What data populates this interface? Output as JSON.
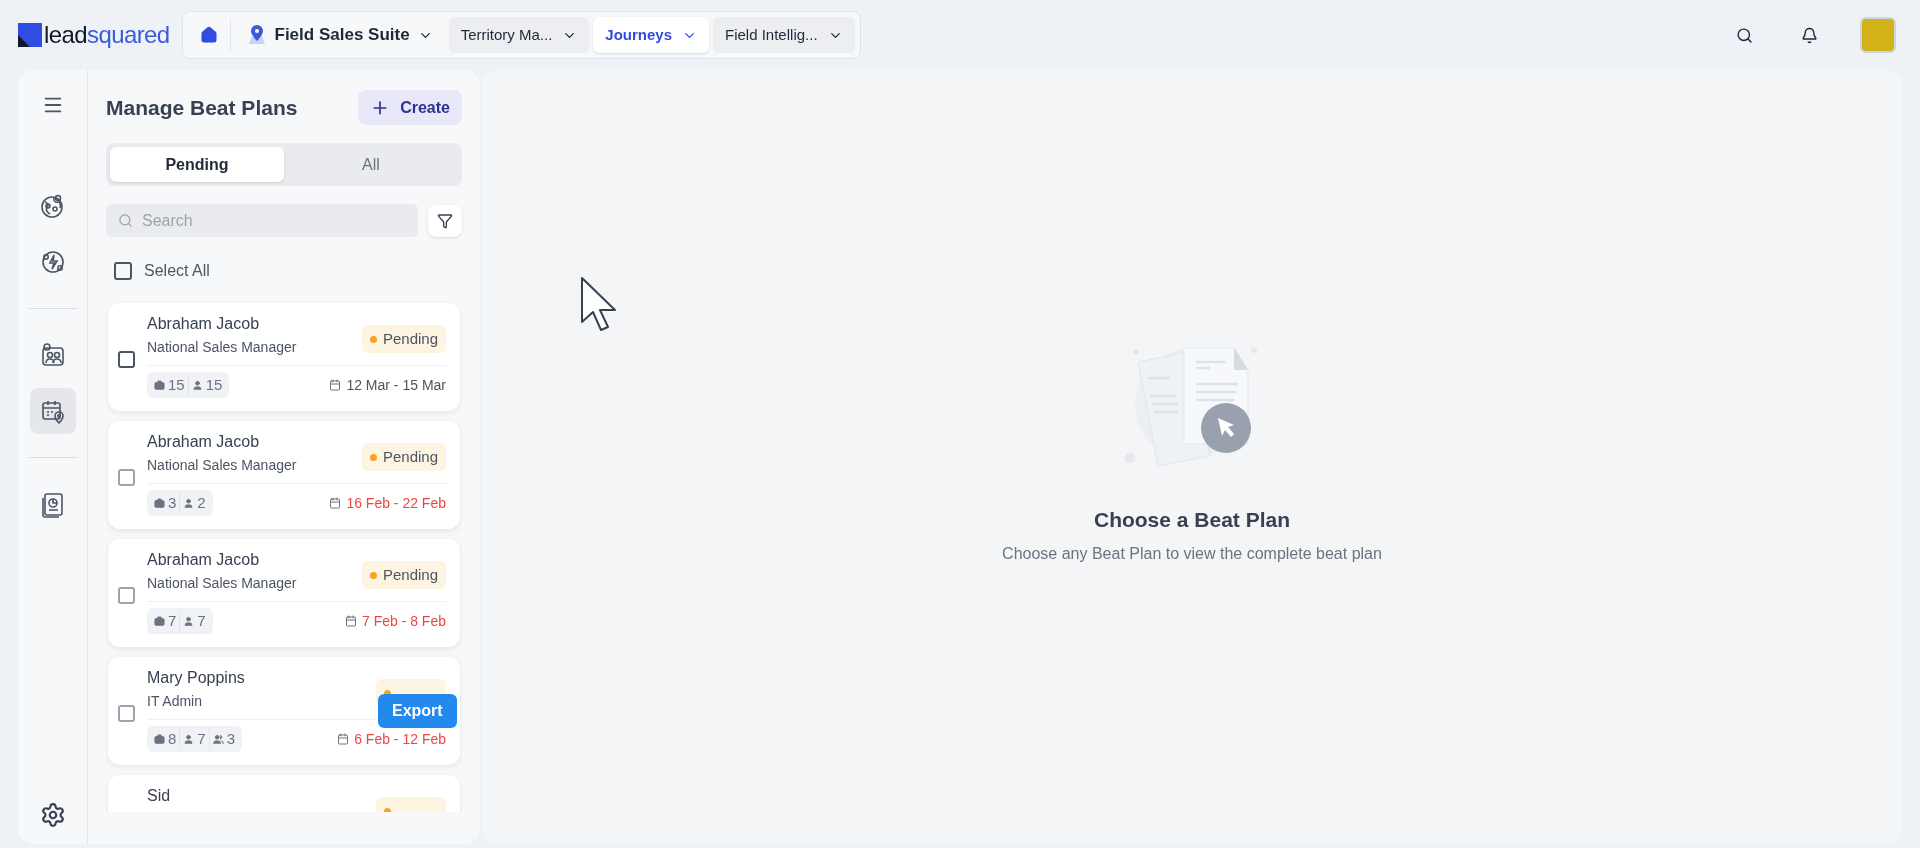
{
  "logo": {
    "text_a": "lead",
    "text_b": "squared"
  },
  "nav": {
    "suite": "Field Sales Suite",
    "tabs": [
      {
        "label": "Territory Ma...",
        "selected": false
      },
      {
        "label": "Journeys",
        "selected": true
      },
      {
        "label": "Field Intellig...",
        "selected": false
      }
    ]
  },
  "rail": [
    {
      "kind": "globe",
      "selected": false
    },
    {
      "kind": "bolt",
      "selected": false
    },
    {
      "kind": "team",
      "selected": false
    },
    {
      "kind": "calendar",
      "selected": true
    },
    {
      "kind": "report",
      "selected": false
    }
  ],
  "panel": {
    "title": "Manage Beat Plans",
    "create": "Create",
    "segments": [
      {
        "label": "Pending",
        "selected": true
      },
      {
        "label": "All",
        "selected": false
      }
    ],
    "search": {
      "placeholder": "Search"
    },
    "select_all": {
      "label": "Select All",
      "checked": false
    }
  },
  "cards": [
    {
      "name": "Abraham Jacob",
      "role": "National Sales Manager",
      "status": "Pending",
      "checked": false,
      "overdue": false,
      "dates": "12 Mar - 15 Mar",
      "counts": [
        {
          "kind": "visits",
          "value": "15"
        },
        {
          "kind": "people",
          "value": "15"
        }
      ]
    },
    {
      "name": "Abraham Jacob",
      "role": "National Sales Manager",
      "status": "Pending",
      "checked": false,
      "overdue": true,
      "dates": "16 Feb - 22 Feb",
      "counts": [
        {
          "kind": "visits",
          "value": "3"
        },
        {
          "kind": "people",
          "value": "2"
        }
      ]
    },
    {
      "name": "Abraham Jacob",
      "role": "National Sales Manager",
      "status": "Pending",
      "checked": false,
      "overdue": true,
      "dates": "7 Feb - 8 Feb",
      "counts": [
        {
          "kind": "visits",
          "value": "7"
        },
        {
          "kind": "people",
          "value": "7"
        }
      ]
    },
    {
      "name": "Mary Poppins",
      "role": "IT Admin",
      "badge": true,
      "checked": false,
      "overdue": true,
      "dates": "6 Feb - 12 Feb",
      "counts": [
        {
          "kind": "visits",
          "value": "8"
        },
        {
          "kind": "people",
          "value": "7"
        },
        {
          "kind": "groups",
          "value": "3"
        }
      ]
    },
    {
      "name": "Sid",
      "badge": true
    }
  ],
  "export_button": "Export",
  "empty_state": {
    "title": "Choose a Beat Plan",
    "text": "Choose any Beat Plan to view the complete beat plan"
  }
}
